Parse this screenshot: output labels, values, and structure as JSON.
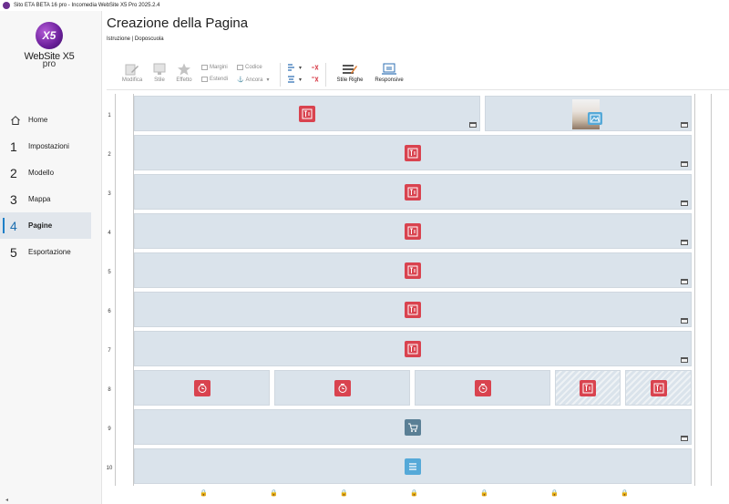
{
  "window": {
    "title": "Sito ETA BETA 16 pro - Incomedia WebSite X5 Pro 2025.2.4"
  },
  "logo": {
    "badge": "X5",
    "name": "WebSite X5",
    "edition": "pro"
  },
  "nav": {
    "home": "Home",
    "items": [
      {
        "num": "1",
        "label": "Impostazioni"
      },
      {
        "num": "2",
        "label": "Modello"
      },
      {
        "num": "3",
        "label": "Mappa"
      },
      {
        "num": "4",
        "label": "Pagine"
      },
      {
        "num": "5",
        "label": "Esportazione"
      }
    ]
  },
  "header": {
    "title": "Creazione della Pagina",
    "breadcrumb": "Istruzione | Doposcuola"
  },
  "toolbar": {
    "modifica": "Modifica",
    "stile": "Stile",
    "effetto": "Effetto",
    "margini": "Margini",
    "codice": "Codice",
    "estendi": "Estendi",
    "ancora": "Ancora",
    "stile_righe": "Stile Righe",
    "responsive": "Responsive"
  },
  "rows": [
    "1",
    "2",
    "3",
    "4",
    "5",
    "6",
    "7",
    "8",
    "9",
    "10"
  ],
  "colors": {
    "accent": "#1e7fc7",
    "cell": "#dae3eb",
    "text_object": "#d9434f",
    "image_object": "#55a9d8",
    "logo": "#6a1f9a"
  }
}
